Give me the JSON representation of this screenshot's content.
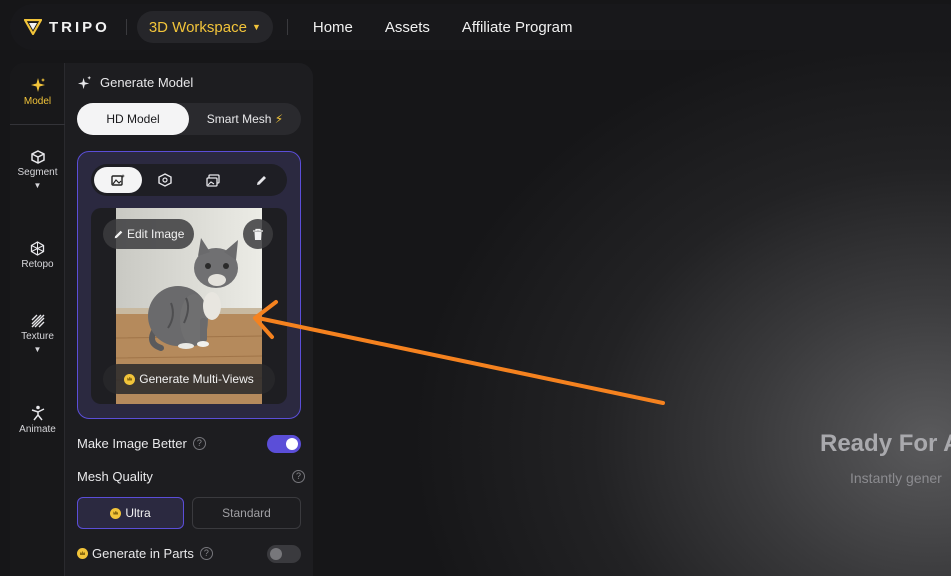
{
  "brand": {
    "name": "TRIPO"
  },
  "header": {
    "workspace_label": "3D Workspace",
    "nav": [
      "Home",
      "Assets",
      "Affiliate Program"
    ]
  },
  "rail": {
    "items": [
      {
        "label": "Model",
        "icon": "sparkle-icon",
        "active": true
      },
      {
        "label": "Segment",
        "icon": "cube-icon",
        "has_dropdown": true
      },
      {
        "label": "Retopo",
        "icon": "mesh-icon"
      },
      {
        "label": "Texture",
        "icon": "texture-icon",
        "has_dropdown": true
      },
      {
        "label": "Animate",
        "icon": "figure-icon"
      }
    ]
  },
  "generate": {
    "title": "Generate Model",
    "mode_options": [
      "HD Model",
      "Smart Mesh"
    ],
    "selected_mode": "HD Model",
    "input_tabs": [
      "image-tab-icon",
      "cube-tab-icon",
      "multi-image-tab-icon",
      "pencil-tab-icon"
    ],
    "edit_image_label": "Edit Image",
    "multi_views_label": "Generate Multi-Views",
    "make_better_label": "Make Image Better",
    "make_better_on": true,
    "mesh_quality_label": "Mesh Quality",
    "quality_options": [
      "Ultra",
      "Standard"
    ],
    "selected_quality": "Ultra",
    "parts_label": "Generate in Parts",
    "parts_on": false
  },
  "hero": {
    "title": "Ready For A",
    "subtitle": "Instantly gener"
  },
  "colors": {
    "accent_purple": "#5b4ed8",
    "accent_gold": "#f2c43a",
    "annotation_arrow": "#f5821f"
  }
}
